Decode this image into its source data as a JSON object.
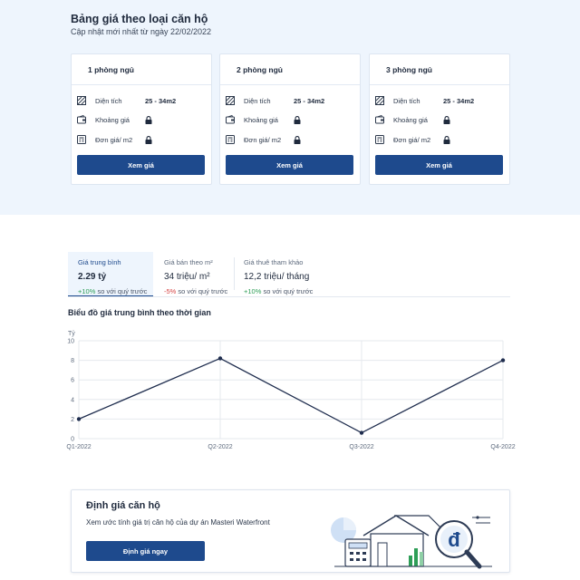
{
  "pricing": {
    "title": "Bảng giá theo loại căn hộ",
    "subtitle": "Cập nhật mới nhất từ ngày 22/02/2022",
    "cards": [
      {
        "title": "1 phòng ngủ",
        "area_label": "Diện tích",
        "area_value": "25 - 34m2",
        "price_range_label": "Khoảng giá",
        "unit_price_label": "Đơn giá/ m2",
        "button": "Xem giá"
      },
      {
        "title": "2 phòng ngủ",
        "area_label": "Diện tích",
        "area_value": "25 - 34m2",
        "price_range_label": "Khoảng giá",
        "unit_price_label": "Đơn giá/ m2",
        "button": "Xem giá"
      },
      {
        "title": "3 phòng ngủ",
        "area_label": "Diện tích",
        "area_value": "25 - 34m2",
        "price_range_label": "Khoảng giá",
        "unit_price_label": "Đơn giá/ m2",
        "button": "Xem giá"
      }
    ]
  },
  "tabs": [
    {
      "label": "Giá trung bình",
      "value": "2.29 tỷ",
      "change": "+10%",
      "change_suffix": " so với quý trước",
      "active": true
    },
    {
      "label": "Giá bán theo m²",
      "value": "34 triệu/ m²",
      "change": "-5%",
      "change_suffix": " so với quý trước",
      "active": false
    },
    {
      "label": "Giá thuê tham khảo",
      "value": "12,2 triệu/ tháng",
      "change": "+10%",
      "change_suffix": " so với quý trước",
      "active": false
    }
  ],
  "chart_title": "Biểu đồ giá trung bình theo thời gian",
  "chart_data": {
    "type": "line",
    "categories": [
      "Q1-2022",
      "Q2-2022",
      "Q3-2022",
      "Q4-2022"
    ],
    "series": [
      {
        "values": [
          2,
          8.2,
          0.6,
          8
        ]
      }
    ],
    "ylabel": "Tỷ",
    "ylim": [
      0,
      10
    ],
    "yticks": [
      0,
      2,
      4,
      6,
      8,
      10
    ],
    "grid": true,
    "line_color": "#1f2d4e",
    "grid_color": "#e6e9ee"
  },
  "valuation": {
    "title": "Định giá căn hộ",
    "description": "Xem ước tính giá trị căn hộ của dự án Masteri Waterfront",
    "button": "Định giá ngay"
  },
  "colors": {
    "primary": "#1e4a8d",
    "band_bg": "#eef5fd",
    "positive": "#2e9e57",
    "negative": "#d64545"
  }
}
